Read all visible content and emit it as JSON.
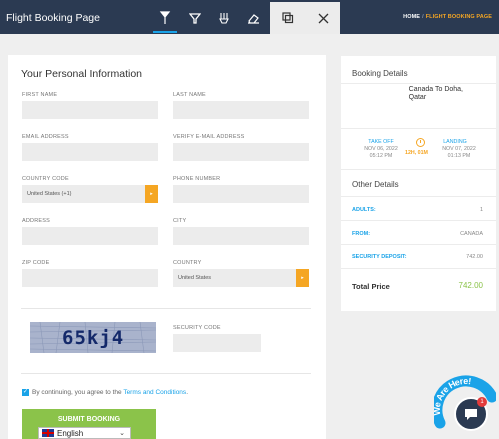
{
  "app": {
    "title": "Flight Booking Page"
  },
  "toolbar": {
    "icons": [
      "cursor-icon",
      "funnel-icon",
      "brush-icon",
      "eraser-icon",
      "copy-icon",
      "close-icon"
    ]
  },
  "breadcrumb": {
    "home": "HOME",
    "separator": "/",
    "current": "FLIGHT BOOKING PAGE"
  },
  "form": {
    "title": "Your Personal Information",
    "fields": {
      "first_name": {
        "label": "FIRST NAME",
        "value": ""
      },
      "last_name": {
        "label": "LAST NAME",
        "value": ""
      },
      "email": {
        "label": "EMAIL ADDRESS",
        "value": ""
      },
      "verify_email": {
        "label": "VERIFY E-MAIL ADDRESS",
        "value": ""
      },
      "country_code": {
        "label": "COUNTRY CODE",
        "value": "United States (+1)"
      },
      "phone": {
        "label": "PHONE NUMBER",
        "value": ""
      },
      "address": {
        "label": "ADDRESS",
        "value": ""
      },
      "city": {
        "label": "CITY",
        "value": ""
      },
      "zip": {
        "label": "ZIP CODE",
        "value": ""
      },
      "country": {
        "label": "COUNTRY",
        "value": "United States"
      },
      "security_code": {
        "label": "SECURITY CODE",
        "value": ""
      }
    },
    "captcha": "65kj4",
    "agree_prefix": "By continuing, you agree to the ",
    "agree_link": "Terms and Conditions",
    "agree_suffix": ".",
    "submit_label": "SUBMIT BOOKING"
  },
  "language": {
    "selected": "English"
  },
  "booking": {
    "title": "Booking Details",
    "route_line1": "Canada To Doha,",
    "route_line2": "Qatar",
    "takeoff": {
      "label": "TAKE OFF",
      "date": "NOV 06, 2022",
      "time": "05:12 PM"
    },
    "duration": "12H, 01M",
    "landing": {
      "label": "LANDING",
      "date": "NOV 07, 2022",
      "time": "01:13 PM"
    }
  },
  "other": {
    "title": "Other Details",
    "rows": [
      {
        "label": "ADULTS:",
        "value": "1"
      },
      {
        "label": "FROM:",
        "value": "CANADA"
      },
      {
        "label": "SECURITY DEPOSIT:",
        "value": "742.00"
      }
    ],
    "total_label": "Total Price",
    "total_value": "742.00"
  },
  "chat": {
    "badge_text": "We Are Here!",
    "unread": "1"
  },
  "colors": {
    "header": "#2b3a52",
    "accent": "#1aa3e8",
    "orange": "#f5a623",
    "green": "#8bc34a"
  }
}
